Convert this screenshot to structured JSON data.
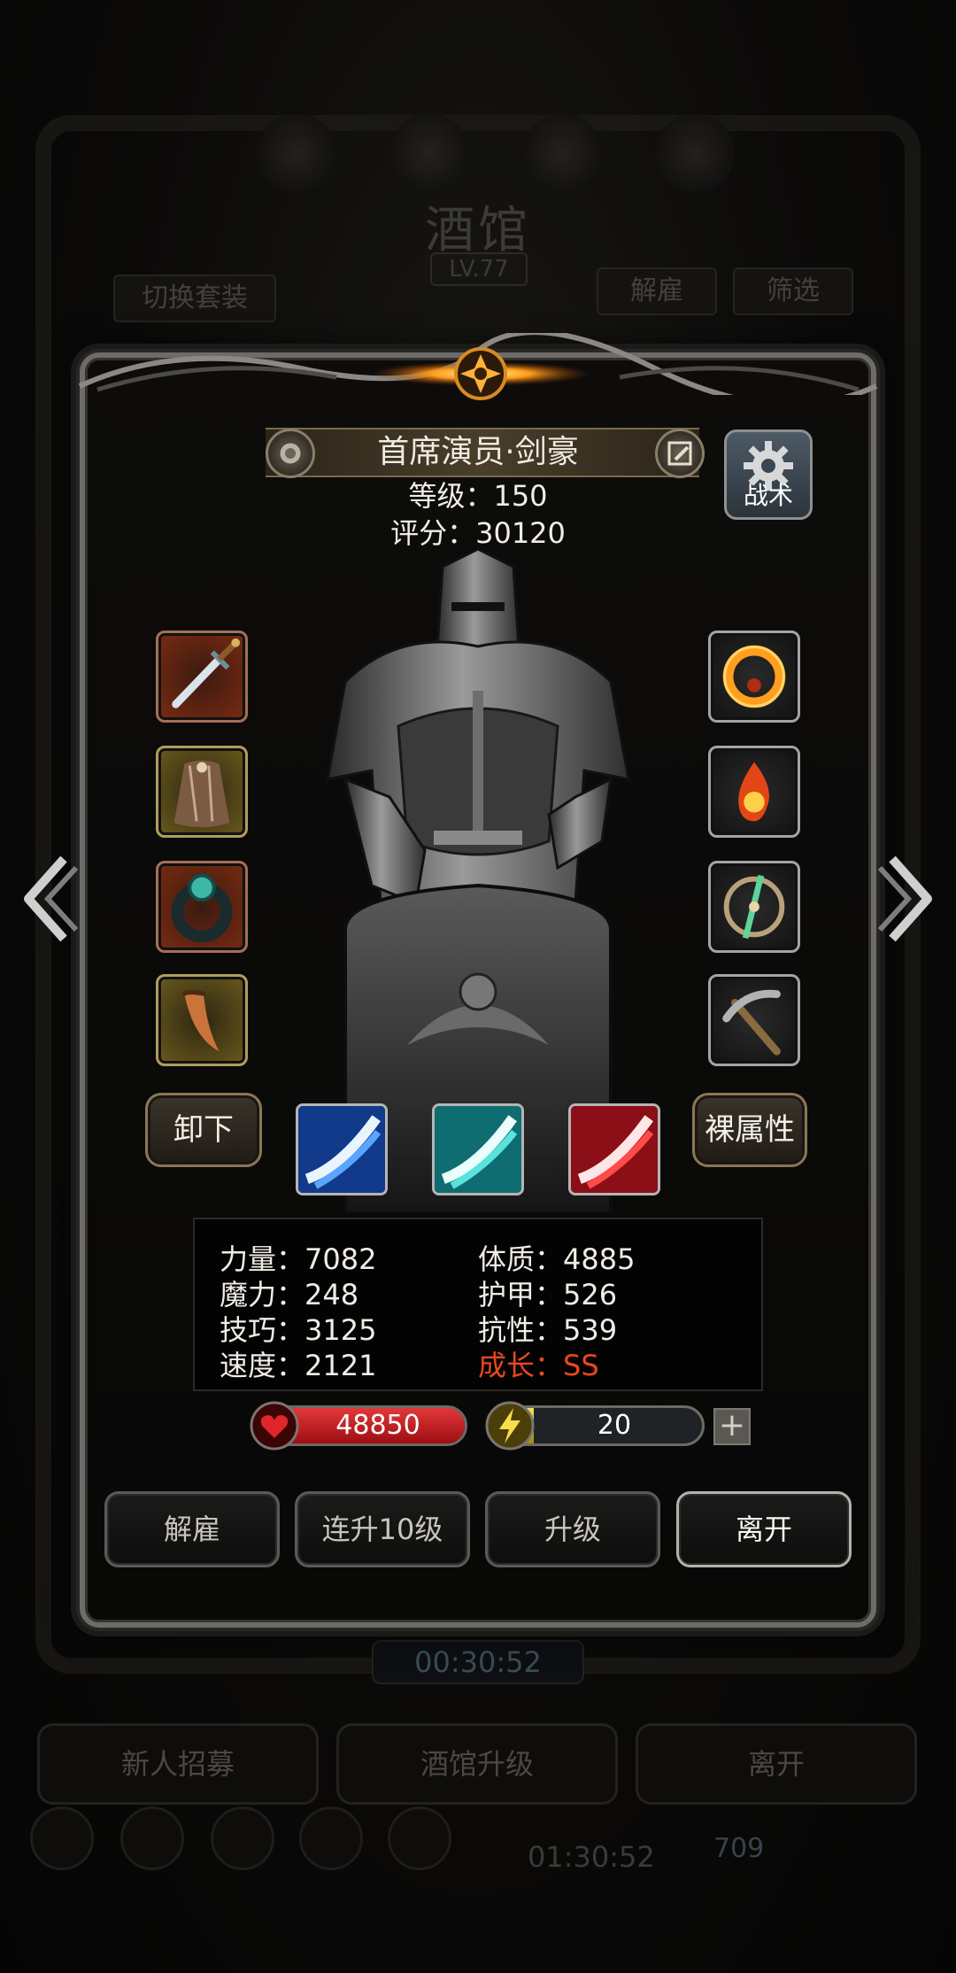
{
  "background": {
    "title": "酒馆",
    "level": "LV.77",
    "switch_outfit": "切换套装",
    "dismiss": "解雇",
    "filter": "筛选",
    "timer": "00:30:52",
    "timer2": "01:30:52",
    "coin": "709",
    "recruit": "新人招募",
    "upgrade_tavern": "酒馆升级",
    "leave": "离开"
  },
  "hero": {
    "name": "首席演员·剑豪",
    "level_label": "等级：150",
    "score_label": "评分：30120",
    "tactics": "战术"
  },
  "equipment": {
    "left": [
      "sword",
      "cloak",
      "ring",
      "horn"
    ],
    "right": [
      "fire-ring",
      "flame-orb",
      "compass-dagger",
      "pickaxe"
    ]
  },
  "buttons": {
    "unequip": "卸下",
    "base_attr": "裸属性"
  },
  "skills": [
    "blue-slash",
    "cyan-slash",
    "red-slash"
  ],
  "stats": {
    "strength": "力量：7082",
    "magic": "魔力：248",
    "skill": "技巧：3125",
    "speed": "速度：2121",
    "constitution": "体质：4885",
    "armor": "护甲：526",
    "resistance": "抗性：539",
    "growth": "成长：SS"
  },
  "resources": {
    "hp": "48850",
    "energy": "20",
    "energy_fill": 0.2
  },
  "actions": {
    "dismiss": "解雇",
    "level_up_10": "连升10级",
    "level_up": "升级",
    "leave": "离开"
  },
  "colors": {
    "growth": "#e8471f",
    "hp": "#c41a1d",
    "energy": "#e0c93a"
  }
}
